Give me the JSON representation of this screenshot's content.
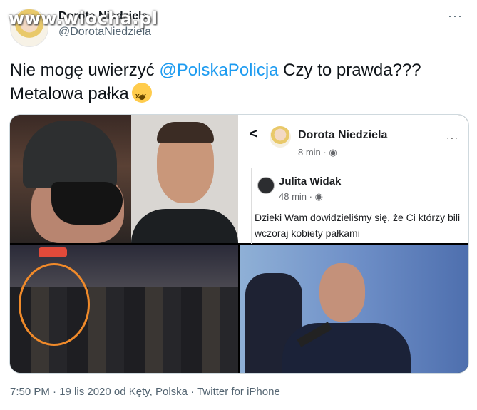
{
  "header": {
    "watermark": "www.wiocha.pl",
    "display_name": "Dorota Niedziela",
    "handle": "@DorotaNiedziela",
    "more_label": "···"
  },
  "tweet": {
    "text_before": "Nie mogę uwierzyć ",
    "mention": "@PolskaPolicja",
    "text_after": " Czy to prawda???",
    "line2": "Metalowa pałka"
  },
  "facebook_post": {
    "back_label": "<",
    "author": "Dorota Niedziela",
    "time": "8 min · ◉",
    "more_label": "···",
    "shared_author": "Julita Widak",
    "shared_time": "48 min · ◉",
    "shared_text": "Dzieki Wam dowidzieliśmy się, że Ci którzy bili wczoraj kobiety pałkami"
  },
  "meta": {
    "text": "7:50 PM · 19 lis 2020 od Kęty, Polska · Twitter for iPhone"
  },
  "colors": {
    "mention": "#1d9bf0",
    "circle_highlight": "#f08a2a"
  }
}
